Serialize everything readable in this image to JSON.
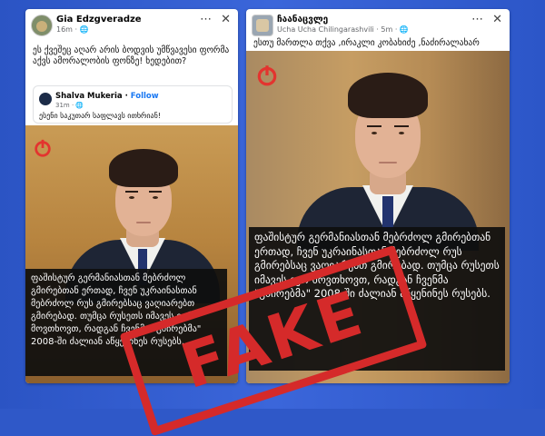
{
  "left_post": {
    "author": "Gia Edzgveradze",
    "time": "16m",
    "caption": "ეს ქვეშეც აღარ არის ბოდვის უმწვავესი ფორმა აქვს ამორალობის ფონზე! ხედებით?",
    "shared_comment": {
      "author": "Shalva Mukeria",
      "follow": "Follow",
      "time": "31m",
      "text": "ესენი საკუთარ საფლავს ითხრიან!"
    },
    "overlay_text": "ფაშისტურ გერმანიასთან მებრძოლ გმირებთან ერთად, ჩვენ უკრაინასთან მებრძოლ რუს გმირებსაც ვაღიარებთ გმირებად. თუმცა რუსეთს იმავეს ვერ მოვთხოვთ, რადგან ჩვენმა \"გმირებმა\" 2008-ში ძალიან აწყენინეს რუსებს."
  },
  "right_post": {
    "author": "ჩაანაცვლე",
    "sub_author": "Ucha Ucha Chilingarashvili",
    "time": "5m",
    "caption": "ესთუ მართლა თქვა ,ირაკლი კობახიძე ,ნაძირალახარ",
    "overlay_text": "ფაშისტურ გერმანიასთან მებრძოლ გმირებთან ერთად, ჩვენ უკრაინასთან მებრძოლ რუს გმირებსაც ვაღიარებთ გმირებად. თუმცა რუსეთს იმავეს ვერ მოვთხოვთ, რადგან ჩვენმა \"გმირებმა\" 2008-ში ძალიან აწყენინეს რუსებს."
  },
  "stamp": {
    "label": "FAKE",
    "color": "#d52a2a"
  },
  "icons": {
    "more": "more-icon",
    "close": "close-icon",
    "globe": "globe-icon",
    "logo": "power-logo-icon"
  },
  "colors": {
    "background": "#2f58c8",
    "follow": "#1877f2",
    "logo": "#e3342f"
  }
}
